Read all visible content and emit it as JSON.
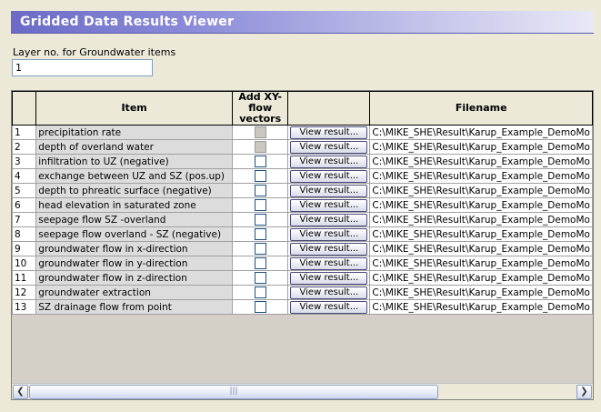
{
  "window": {
    "title": "Gridded Data Results Viewer"
  },
  "layer": {
    "label": "Layer no. for Groundwater items",
    "value": "1"
  },
  "grid": {
    "headers": {
      "rownum": "",
      "item": "Item",
      "xy": "Add XY-flow vectors",
      "button": "",
      "filename": "Filename"
    },
    "button_label": "View result...",
    "rows": [
      {
        "num": "1",
        "item": "precipitation rate",
        "file": "C:\\MIKE_SHE\\Result\\Karup_Example_DemoMo",
        "xy_disabled": true
      },
      {
        "num": "2",
        "item": "depth of overland water",
        "file": "C:\\MIKE_SHE\\Result\\Karup_Example_DemoMo",
        "xy_disabled": true
      },
      {
        "num": "3",
        "item": "infiltration to UZ (negative)",
        "file": "C:\\MIKE_SHE\\Result\\Karup_Example_DemoMo",
        "xy_disabled": false
      },
      {
        "num": "4",
        "item": "exchange between UZ and SZ (pos.up)",
        "file": "C:\\MIKE_SHE\\Result\\Karup_Example_DemoMo",
        "xy_disabled": false
      },
      {
        "num": "5",
        "item": "depth to phreatic surface (negative)",
        "file": "C:\\MIKE_SHE\\Result\\Karup_Example_DemoMo",
        "xy_disabled": false
      },
      {
        "num": "6",
        "item": "head elevation in saturated zone",
        "file": "C:\\MIKE_SHE\\Result\\Karup_Example_DemoMo",
        "xy_disabled": false
      },
      {
        "num": "7",
        "item": "seepage flow SZ -overland",
        "file": "C:\\MIKE_SHE\\Result\\Karup_Example_DemoMo",
        "xy_disabled": false
      },
      {
        "num": "8",
        "item": "seepage flow overland - SZ (negative)",
        "file": "C:\\MIKE_SHE\\Result\\Karup_Example_DemoMo",
        "xy_disabled": false
      },
      {
        "num": "9",
        "item": "groundwater flow in x-direction",
        "file": "C:\\MIKE_SHE\\Result\\Karup_Example_DemoMo",
        "xy_disabled": false
      },
      {
        "num": "10",
        "item": "groundwater flow in y-direction",
        "file": "C:\\MIKE_SHE\\Result\\Karup_Example_DemoMo",
        "xy_disabled": false
      },
      {
        "num": "11",
        "item": "groundwater flow in z-direction",
        "file": "C:\\MIKE_SHE\\Result\\Karup_Example_DemoMo",
        "xy_disabled": false
      },
      {
        "num": "12",
        "item": "groundwater extraction",
        "file": "C:\\MIKE_SHE\\Result\\Karup_Example_DemoMo",
        "xy_disabled": false
      },
      {
        "num": "13",
        "item": "SZ drainage flow from point",
        "file": "C:\\MIKE_SHE\\Result\\Karup_Example_DemoMo",
        "xy_disabled": false
      }
    ]
  },
  "scrollbar": {
    "left_icon": "chevron-left-icon",
    "right_icon": "chevron-right-icon",
    "thumb_grip": "|||"
  },
  "colors": {
    "title_gradient_start": "#6b6bc7",
    "title_gradient_end": "#e8e8f7",
    "item_cell_bg": "#dcdcdc",
    "window_bg": "#ece9d8"
  }
}
